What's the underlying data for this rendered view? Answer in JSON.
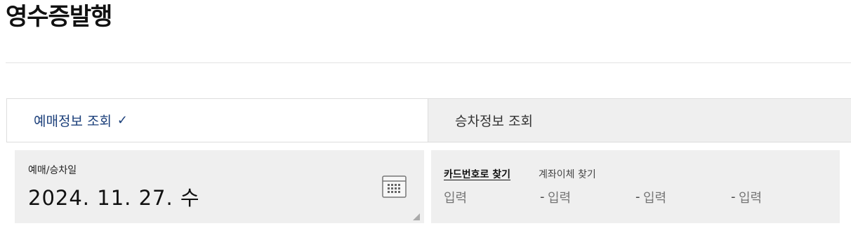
{
  "page": {
    "title": "영수증발행"
  },
  "tabs": [
    {
      "label": "예매정보 조회",
      "check": "✓",
      "active": true
    },
    {
      "label": "승차정보 조회",
      "active": false
    }
  ],
  "date_field": {
    "label": "예매/승차일",
    "value": "2024. 11. 27. 수",
    "icon": "calendar-icon"
  },
  "card_search": {
    "options": [
      "카드번호로 찾기",
      "계좌이체 찾기"
    ],
    "selected": "카드번호로 찾기",
    "fields": [
      {
        "placeholder": "입력"
      },
      {
        "placeholder": "입력"
      },
      {
        "placeholder": "입력"
      },
      {
        "placeholder": "입력"
      }
    ],
    "separator": "-"
  },
  "colors": {
    "active_tab_text": "#1b3f7a",
    "panel_bg": "#efefef",
    "border": "#dddddd"
  }
}
